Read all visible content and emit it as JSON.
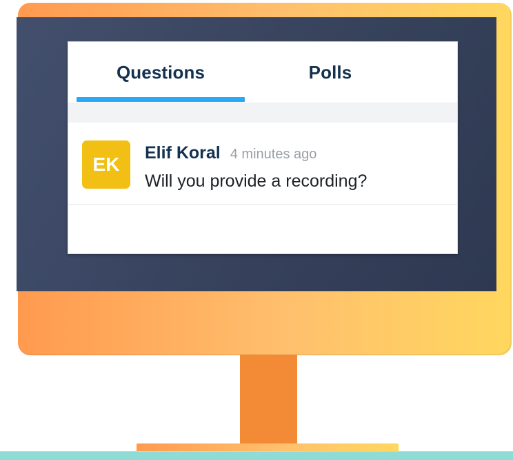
{
  "tabs": [
    {
      "label": "Questions",
      "active": true
    },
    {
      "label": "Polls",
      "active": false
    }
  ],
  "question": {
    "avatar_initials": "EK",
    "author": "Elif Koral",
    "time": "4 minutes ago",
    "text": "Will you provide a recording?"
  },
  "colors": {
    "monitor_gradient_start": "#ff9a4f",
    "monitor_gradient_end": "#ffd75e",
    "screen": "#37425d",
    "active_tab_indicator": "#29a8f5",
    "avatar": "#f2c014",
    "floor": "#8fdcd7",
    "stand": "#f28a36"
  },
  "icons": []
}
